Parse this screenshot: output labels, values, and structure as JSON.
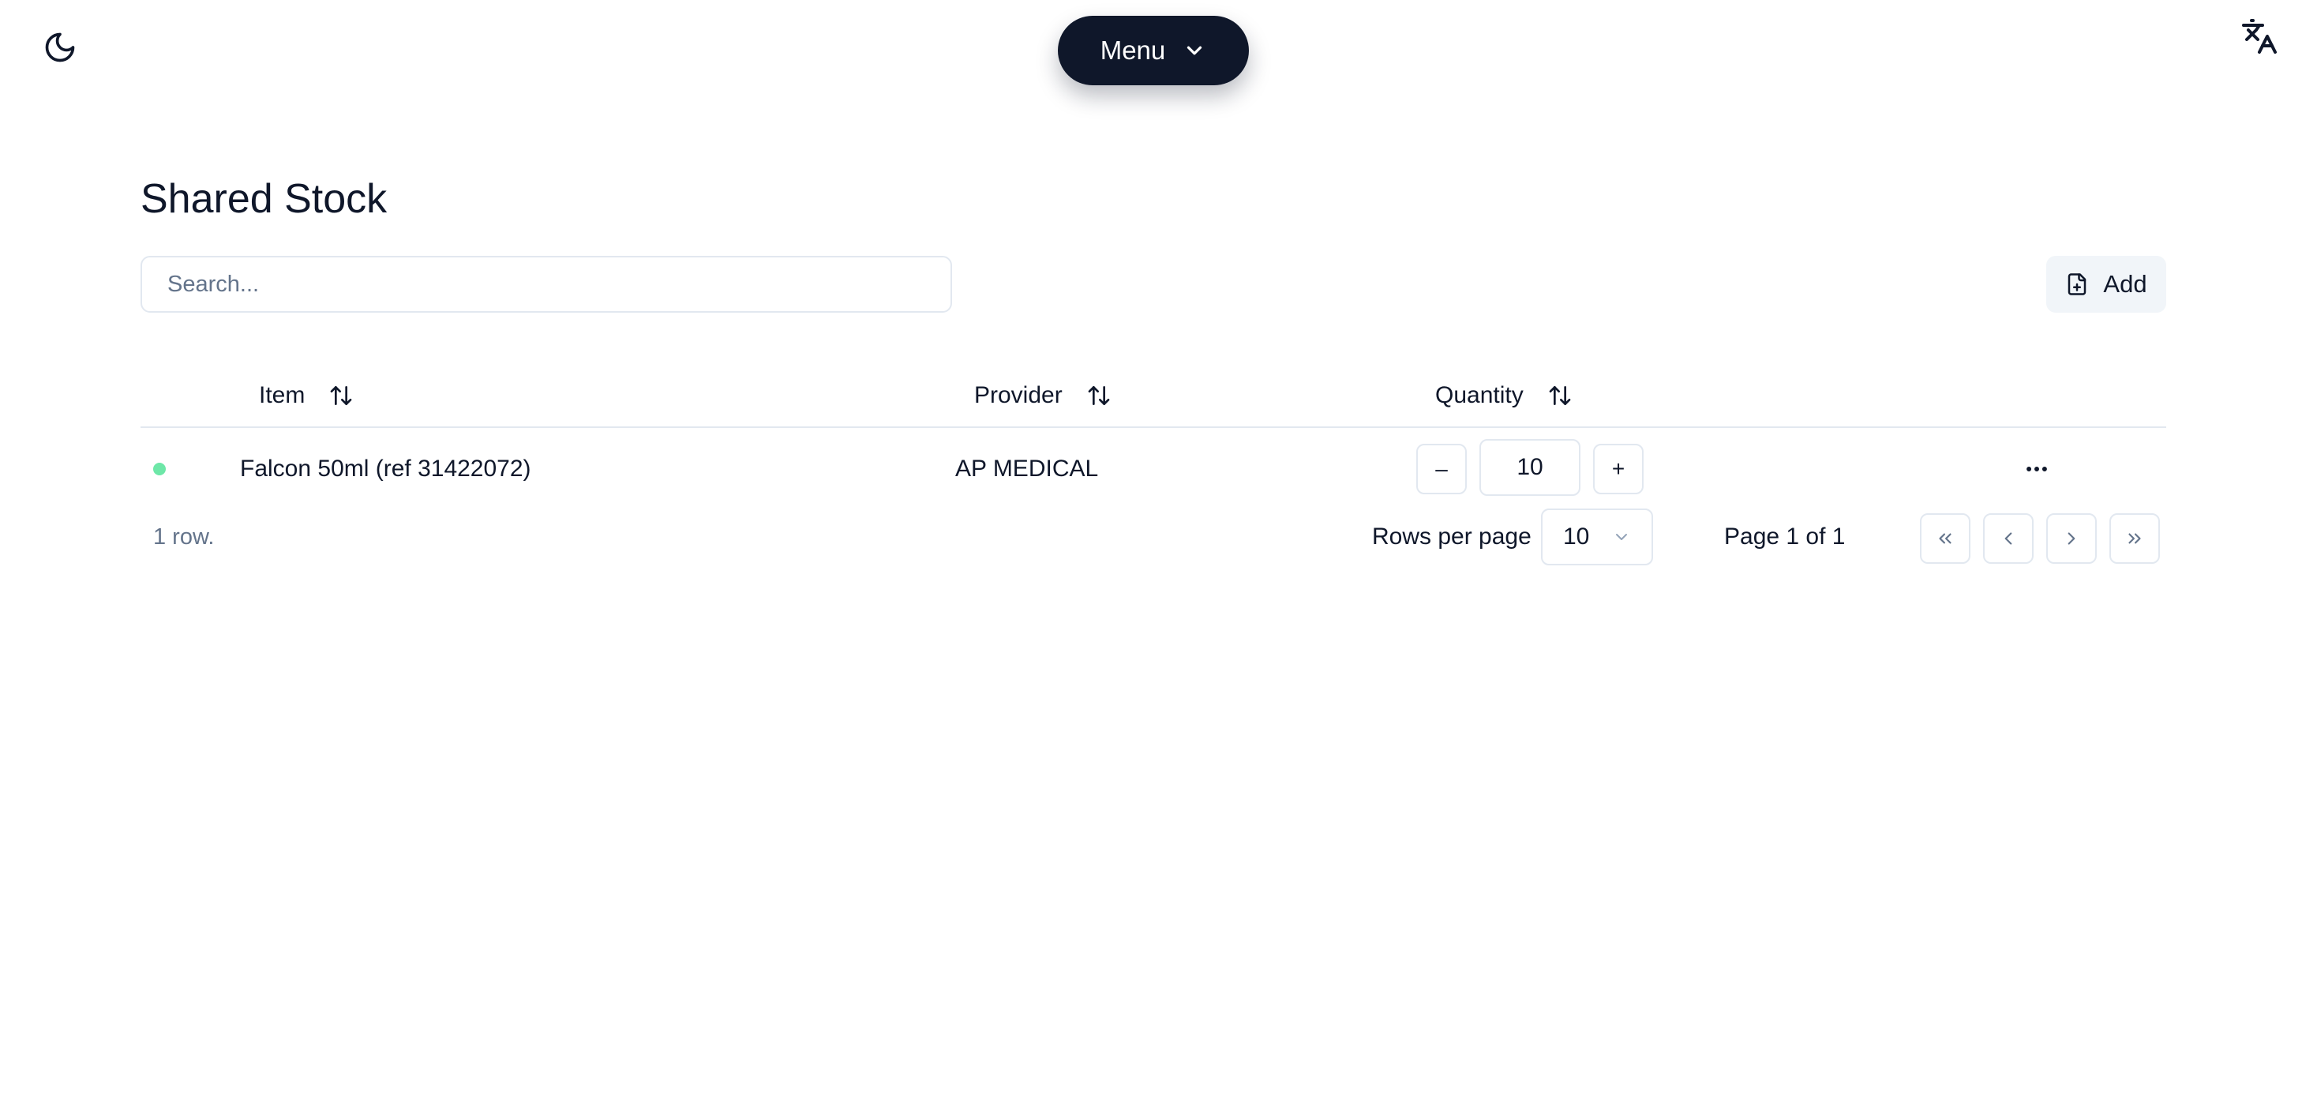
{
  "header": {
    "menu_label": "Menu",
    "icons": {
      "theme": "moon-icon",
      "language": "translate-icon",
      "menu": "chevron-down-icon"
    }
  },
  "page": {
    "title": "Shared Stock",
    "search_placeholder": "Search...",
    "add_label": "Add"
  },
  "table": {
    "columns": [
      "Item",
      "Provider",
      "Quantity"
    ],
    "rows": [
      {
        "status_color": "#6ee7a8",
        "item": "Falcon 50ml (ref 31422072)",
        "provider": "AP MEDICAL",
        "quantity": "10",
        "decrement": "–",
        "increment": "+"
      }
    ]
  },
  "pagination": {
    "row_count": "1 row.",
    "rows_per_page_label": "Rows per page",
    "rows_per_page": "10",
    "page_info": "Page 1 of 1"
  },
  "colors": {
    "menu_background": "#0f172a",
    "status_active": "#6ee7a8",
    "border": "#e2e8f0",
    "muted_text": "#64748b"
  }
}
